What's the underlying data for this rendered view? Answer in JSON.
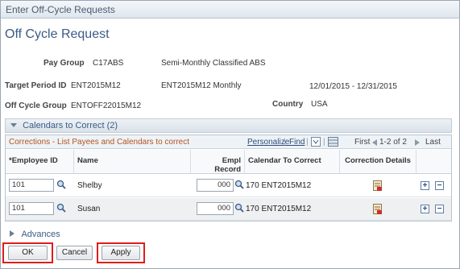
{
  "header": {
    "title": "Enter Off-Cycle Requests"
  },
  "page_title": "Off Cycle Request",
  "info": {
    "pay_group_label": "Pay Group",
    "pay_group_value": "C17ABS",
    "pay_group_desc": "Semi-Monthly Classified ABS",
    "target_period_label": "Target Period ID",
    "target_period_value": "ENT2015M12",
    "target_period_desc": "ENT2015M12 Monthly",
    "period_dates": "12/01/2015 - 12/31/2015",
    "off_cycle_group_label": "Off Cycle Group",
    "off_cycle_group_value": "ENTOFF22015M12",
    "country_label": "Country",
    "country_value": "USA"
  },
  "calendars_section": {
    "label": "Calendars to Correct (2)"
  },
  "grid": {
    "title": "Corrections - List Payees and Calendars to correct",
    "personalize": "Personalize",
    "find": "Find",
    "first": "First",
    "range": "1-2 of 2",
    "last": "Last",
    "columns": [
      "*Employee ID",
      "Name",
      "Empl Record",
      "Calendar To Correct",
      "Correction Details"
    ],
    "rows": [
      {
        "employee_id": "101",
        "name": "Shelby",
        "empl_record": "000",
        "calendar": "170 ENT2015M12"
      },
      {
        "employee_id": "101",
        "name": "Susan",
        "empl_record": "000",
        "calendar": "170 ENT2015M12"
      }
    ]
  },
  "advances": {
    "label": "Advances"
  },
  "buttons": {
    "ok": "OK",
    "cancel": "Cancel",
    "apply": "Apply"
  },
  "colors": {
    "highlight": "#e11c1c",
    "accent": "#3b5b86",
    "grid_title": "#b6521d"
  },
  "icons": [
    "magnifier-icon",
    "correction-details-icon",
    "add-row-icon",
    "delete-row-icon",
    "expand-icon",
    "collapse-icon",
    "download-icon",
    "zoom-grid-icon"
  ]
}
